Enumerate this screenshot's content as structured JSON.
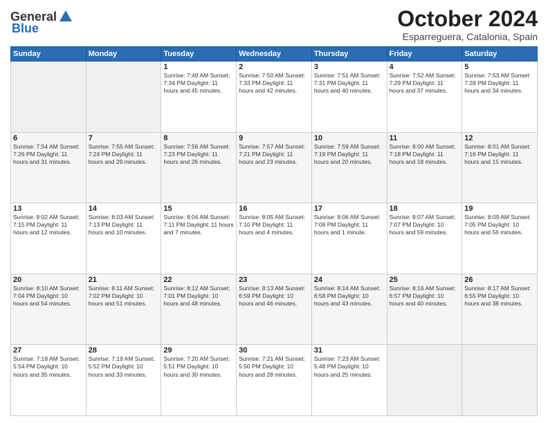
{
  "logo": {
    "general": "General",
    "blue": "Blue"
  },
  "title": "October 2024",
  "location": "Esparreguera, Catalonia, Spain",
  "weekdays": [
    "Sunday",
    "Monday",
    "Tuesday",
    "Wednesday",
    "Thursday",
    "Friday",
    "Saturday"
  ],
  "weeks": [
    [
      {
        "day": "",
        "info": ""
      },
      {
        "day": "",
        "info": ""
      },
      {
        "day": "1",
        "info": "Sunrise: 7:49 AM\nSunset: 7:34 PM\nDaylight: 11 hours and 45 minutes."
      },
      {
        "day": "2",
        "info": "Sunrise: 7:50 AM\nSunset: 7:33 PM\nDaylight: 11 hours and 42 minutes."
      },
      {
        "day": "3",
        "info": "Sunrise: 7:51 AM\nSunset: 7:31 PM\nDaylight: 11 hours and 40 minutes."
      },
      {
        "day": "4",
        "info": "Sunrise: 7:52 AM\nSunset: 7:29 PM\nDaylight: 11 hours and 37 minutes."
      },
      {
        "day": "5",
        "info": "Sunrise: 7:53 AM\nSunset: 7:28 PM\nDaylight: 11 hours and 34 minutes."
      }
    ],
    [
      {
        "day": "6",
        "info": "Sunrise: 7:54 AM\nSunset: 7:26 PM\nDaylight: 11 hours and 31 minutes."
      },
      {
        "day": "7",
        "info": "Sunrise: 7:55 AM\nSunset: 7:24 PM\nDaylight: 11 hours and 29 minutes."
      },
      {
        "day": "8",
        "info": "Sunrise: 7:56 AM\nSunset: 7:23 PM\nDaylight: 11 hours and 26 minutes."
      },
      {
        "day": "9",
        "info": "Sunrise: 7:57 AM\nSunset: 7:21 PM\nDaylight: 11 hours and 23 minutes."
      },
      {
        "day": "10",
        "info": "Sunrise: 7:59 AM\nSunset: 7:19 PM\nDaylight: 11 hours and 20 minutes."
      },
      {
        "day": "11",
        "info": "Sunrise: 8:00 AM\nSunset: 7:18 PM\nDaylight: 11 hours and 18 minutes."
      },
      {
        "day": "12",
        "info": "Sunrise: 8:01 AM\nSunset: 7:16 PM\nDaylight: 11 hours and 15 minutes."
      }
    ],
    [
      {
        "day": "13",
        "info": "Sunrise: 8:02 AM\nSunset: 7:15 PM\nDaylight: 11 hours and 12 minutes."
      },
      {
        "day": "14",
        "info": "Sunrise: 8:03 AM\nSunset: 7:13 PM\nDaylight: 11 hours and 10 minutes."
      },
      {
        "day": "15",
        "info": "Sunrise: 8:04 AM\nSunset: 7:11 PM\nDaylight: 11 hours and 7 minutes."
      },
      {
        "day": "16",
        "info": "Sunrise: 8:05 AM\nSunset: 7:10 PM\nDaylight: 11 hours and 4 minutes."
      },
      {
        "day": "17",
        "info": "Sunrise: 8:06 AM\nSunset: 7:08 PM\nDaylight: 11 hours and 1 minute."
      },
      {
        "day": "18",
        "info": "Sunrise: 8:07 AM\nSunset: 7:07 PM\nDaylight: 10 hours and 59 minutes."
      },
      {
        "day": "19",
        "info": "Sunrise: 8:09 AM\nSunset: 7:05 PM\nDaylight: 10 hours and 56 minutes."
      }
    ],
    [
      {
        "day": "20",
        "info": "Sunrise: 8:10 AM\nSunset: 7:04 PM\nDaylight: 10 hours and 54 minutes."
      },
      {
        "day": "21",
        "info": "Sunrise: 8:11 AM\nSunset: 7:02 PM\nDaylight: 10 hours and 51 minutes."
      },
      {
        "day": "22",
        "info": "Sunrise: 8:12 AM\nSunset: 7:01 PM\nDaylight: 10 hours and 48 minutes."
      },
      {
        "day": "23",
        "info": "Sunrise: 8:13 AM\nSunset: 6:59 PM\nDaylight: 10 hours and 46 minutes."
      },
      {
        "day": "24",
        "info": "Sunrise: 8:14 AM\nSunset: 6:58 PM\nDaylight: 10 hours and 43 minutes."
      },
      {
        "day": "25",
        "info": "Sunrise: 8:16 AM\nSunset: 6:57 PM\nDaylight: 10 hours and 40 minutes."
      },
      {
        "day": "26",
        "info": "Sunrise: 8:17 AM\nSunset: 6:55 PM\nDaylight: 10 hours and 38 minutes."
      }
    ],
    [
      {
        "day": "27",
        "info": "Sunrise: 7:18 AM\nSunset: 5:54 PM\nDaylight: 10 hours and 35 minutes."
      },
      {
        "day": "28",
        "info": "Sunrise: 7:19 AM\nSunset: 5:52 PM\nDaylight: 10 hours and 33 minutes."
      },
      {
        "day": "29",
        "info": "Sunrise: 7:20 AM\nSunset: 5:51 PM\nDaylight: 10 hours and 30 minutes."
      },
      {
        "day": "30",
        "info": "Sunrise: 7:21 AM\nSunset: 5:50 PM\nDaylight: 10 hours and 28 minutes."
      },
      {
        "day": "31",
        "info": "Sunrise: 7:23 AM\nSunset: 5:48 PM\nDaylight: 10 hours and 25 minutes."
      },
      {
        "day": "",
        "info": ""
      },
      {
        "day": "",
        "info": ""
      }
    ]
  ]
}
